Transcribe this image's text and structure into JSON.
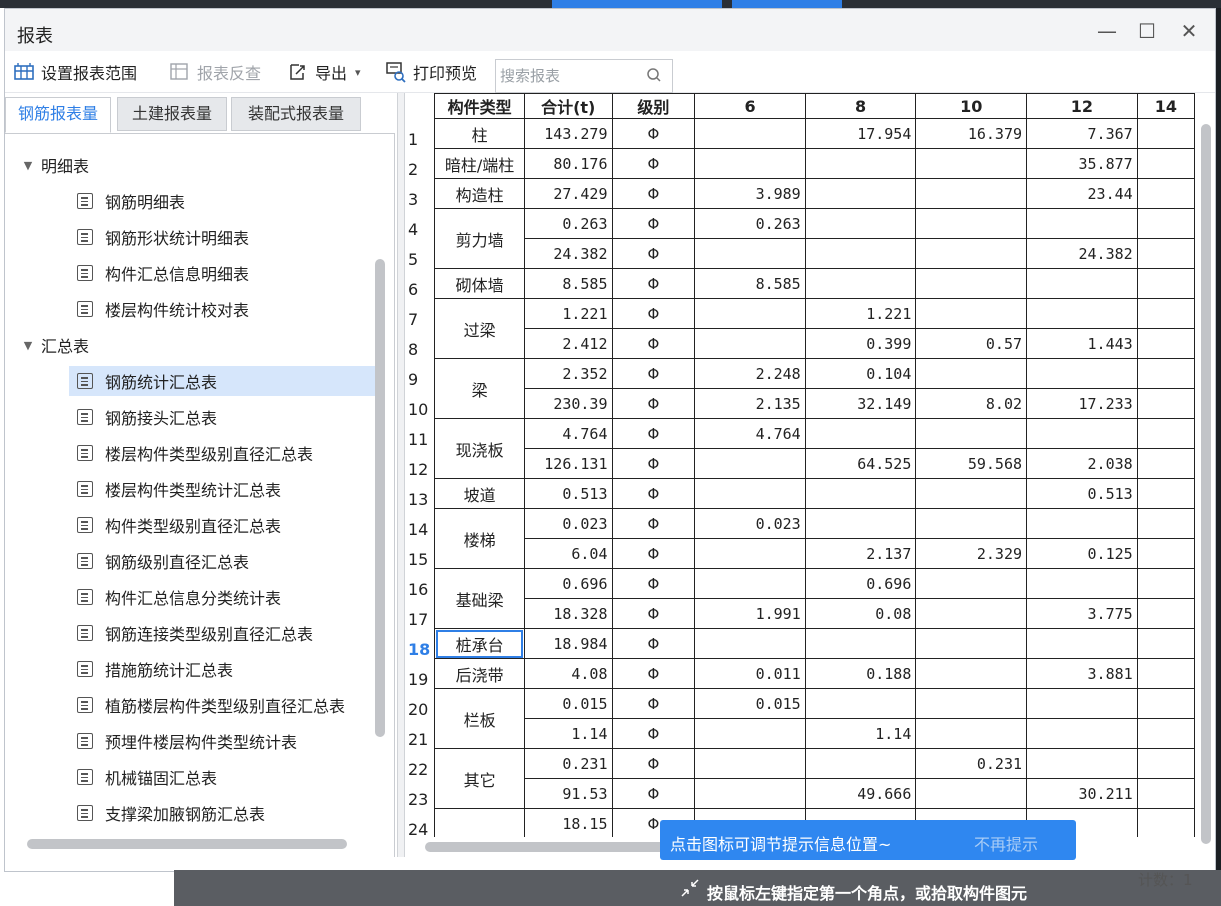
{
  "window": {
    "title": "报表"
  },
  "toolbar": {
    "set_range": "设置报表范围",
    "reverse_check": "报表反查",
    "export": "导出",
    "print_preview": "打印预览",
    "search_placeholder": "搜索报表"
  },
  "tabs": [
    {
      "label": "钢筋报表量",
      "active": true
    },
    {
      "label": "土建报表量",
      "active": false
    },
    {
      "label": "装配式报表量",
      "active": false
    }
  ],
  "tree": {
    "group1": "明细表",
    "items1": [
      "钢筋明细表",
      "钢筋形状统计明细表",
      "构件汇总信息明细表",
      "楼层构件统计校对表"
    ],
    "group2": "汇总表",
    "items2": [
      "钢筋统计汇总表",
      "钢筋接头汇总表",
      "楼层构件类型级别直径汇总表",
      "楼层构件类型统计汇总表",
      "构件类型级别直径汇总表",
      "钢筋级别直径汇总表",
      "构件汇总信息分类统计表",
      "钢筋连接类型级别直径汇总表",
      "措施筋统计汇总表",
      "植筋楼层构件类型级别直径汇总表",
      "预埋件楼层构件类型统计表",
      "机械锚固汇总表",
      "支撑梁加腋钢筋汇总表"
    ],
    "selected": "钢筋统计汇总表"
  },
  "table": {
    "headers": [
      "构件类型",
      "合计(t)",
      "级别",
      "6",
      "8",
      "10",
      "12",
      "14"
    ],
    "groups": [
      {
        "type": "柱",
        "rows": [
          [
            "143.279",
            "Φ",
            "",
            "17.954",
            "16.379",
            "7.367"
          ]
        ]
      },
      {
        "type": "暗柱/端柱",
        "rows": [
          [
            "80.176",
            "Φ",
            "",
            "",
            "",
            "35.877"
          ]
        ]
      },
      {
        "type": "构造柱",
        "rows": [
          [
            "27.429",
            "Φ",
            "3.989",
            "",
            "",
            "23.44"
          ]
        ]
      },
      {
        "type": "剪力墙",
        "rows": [
          [
            "0.263",
            "Φ",
            "0.263",
            "",
            "",
            ""
          ],
          [
            "24.382",
            "Φ",
            "",
            "",
            "",
            "24.382"
          ]
        ]
      },
      {
        "type": "砌体墙",
        "rows": [
          [
            "8.585",
            "Φ",
            "8.585",
            "",
            "",
            ""
          ]
        ]
      },
      {
        "type": "过梁",
        "rows": [
          [
            "1.221",
            "Φ",
            "",
            "1.221",
            "",
            ""
          ],
          [
            "2.412",
            "Φ",
            "",
            "0.399",
            "0.57",
            "1.443"
          ]
        ]
      },
      {
        "type": "梁",
        "rows": [
          [
            "2.352",
            "Φ",
            "2.248",
            "0.104",
            "",
            ""
          ],
          [
            "230.39",
            "Φ",
            "2.135",
            "32.149",
            "8.02",
            "17.233"
          ]
        ]
      },
      {
        "type": "现浇板",
        "rows": [
          [
            "4.764",
            "Φ",
            "4.764",
            "",
            "",
            ""
          ],
          [
            "126.131",
            "Φ",
            "",
            "64.525",
            "59.568",
            "2.038"
          ]
        ]
      },
      {
        "type": "坡道",
        "rows": [
          [
            "0.513",
            "Φ",
            "",
            "",
            "",
            "0.513"
          ]
        ]
      },
      {
        "type": "楼梯",
        "rows": [
          [
            "0.023",
            "Φ",
            "0.023",
            "",
            "",
            ""
          ],
          [
            "6.04",
            "Φ",
            "",
            "2.137",
            "2.329",
            "0.125"
          ]
        ]
      },
      {
        "type": "基础梁",
        "rows": [
          [
            "0.696",
            "Φ",
            "",
            "0.696",
            "",
            ""
          ],
          [
            "18.328",
            "Φ",
            "1.991",
            "0.08",
            "",
            "3.775"
          ]
        ]
      },
      {
        "type": "桩承台",
        "selected": true,
        "rows": [
          [
            "18.984",
            "Φ",
            "",
            "",
            "",
            ""
          ]
        ]
      },
      {
        "type": "后浇带",
        "rows": [
          [
            "4.08",
            "Φ",
            "0.011",
            "0.188",
            "",
            "3.881"
          ]
        ]
      },
      {
        "type": "栏板",
        "rows": [
          [
            "0.015",
            "Φ",
            "0.015",
            "",
            "",
            ""
          ],
          [
            "1.14",
            "Φ",
            "",
            "1.14",
            "",
            ""
          ]
        ]
      },
      {
        "type": "其它",
        "rows": [
          [
            "0.231",
            "Φ",
            "",
            "",
            "0.231",
            ""
          ],
          [
            "91.53",
            "Φ",
            "",
            "49.666",
            "",
            "30.211"
          ]
        ]
      },
      {
        "type": "",
        "rows": [
          [
            "18.15",
            "Φ",
            "",
            "",
            "",
            ""
          ]
        ]
      }
    ]
  },
  "tip": {
    "message": "点击图标可调节提示信息位置~",
    "dismiss": "不再提示"
  },
  "status": {
    "message": "按鼠标左键指定第一个角点，或拾取构件图元",
    "count_label": "计数：1"
  }
}
